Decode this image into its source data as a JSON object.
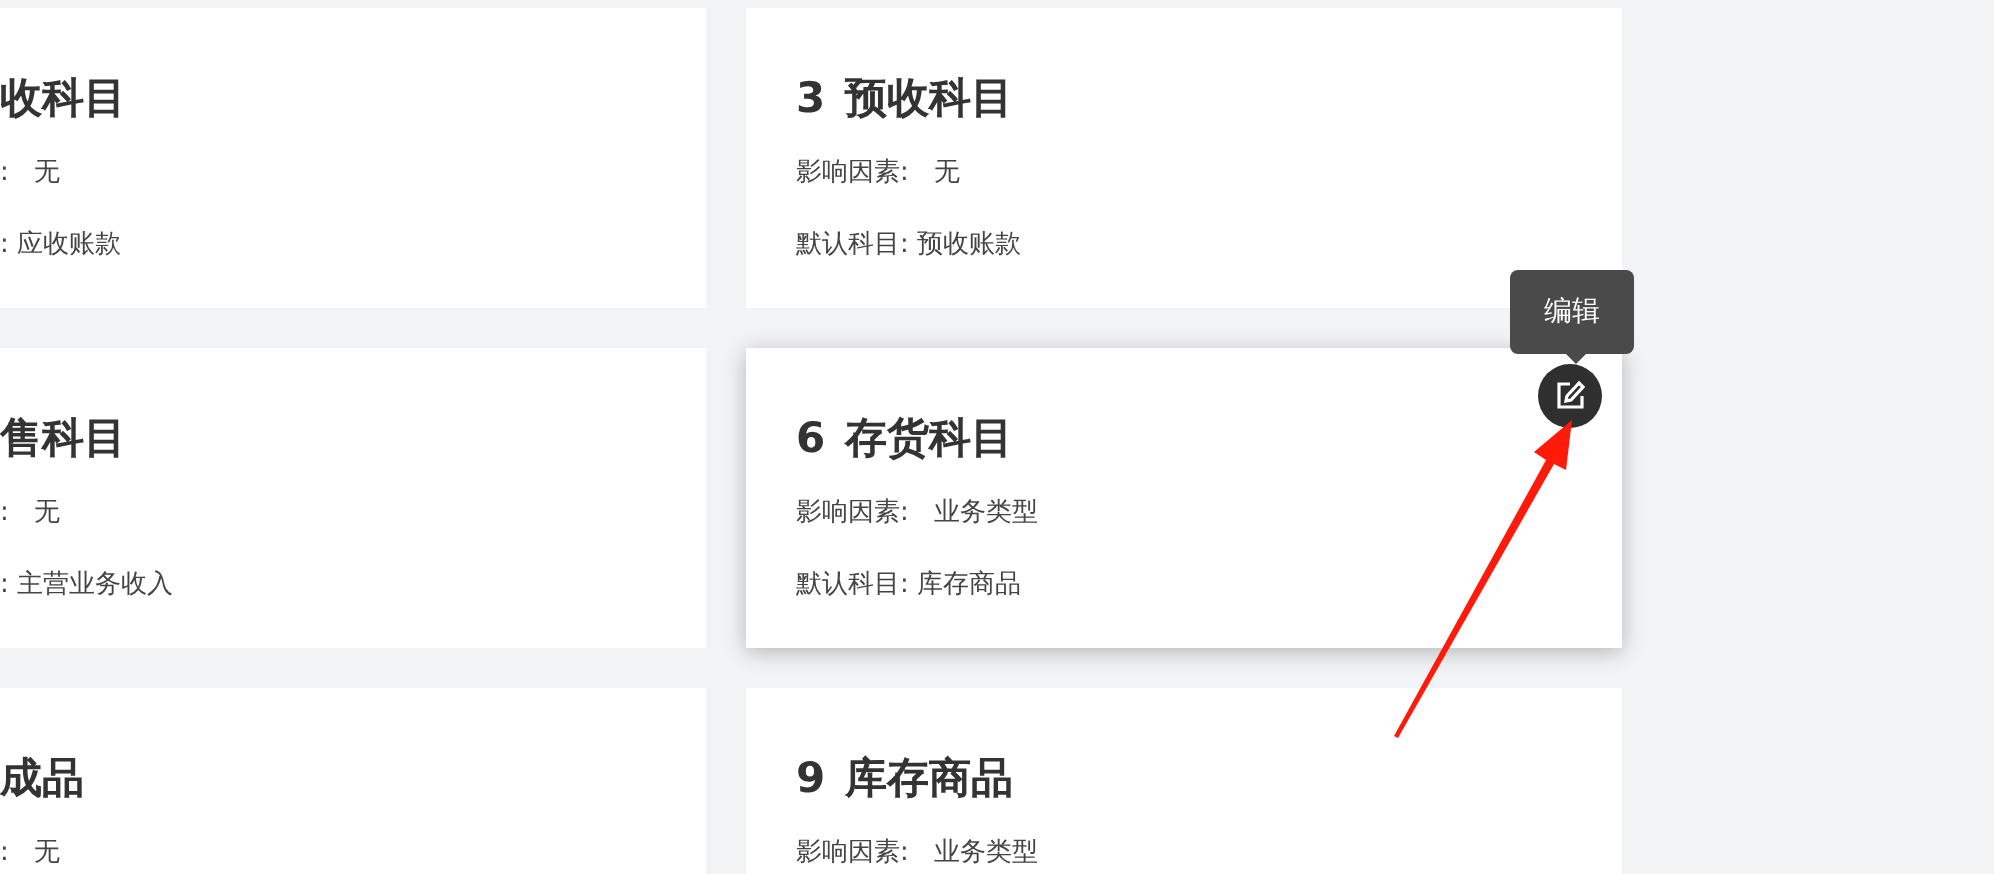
{
  "cards": [
    {
      "title": "收科目",
      "fields": [
        ":   无",
        ": 应收账款"
      ],
      "hovered": false
    },
    {
      "number": "3",
      "title": "预收科目",
      "fields": [
        "影响因素:   无",
        "默认科目: 预收账款"
      ],
      "hovered": false
    },
    {
      "title": "售科目",
      "fields": [
        ":   无",
        ": 主营业务收入"
      ],
      "hovered": false
    },
    {
      "number": "6",
      "title": "存货科目",
      "fields": [
        "影响因素:   业务类型",
        "默认科目: 库存商品"
      ],
      "hovered": true
    },
    {
      "title": "成品",
      "fields": [
        ":   无"
      ],
      "hovered": false
    },
    {
      "number": "9",
      "title": "库存商品",
      "fields": [
        "影响因素:   业务类型"
      ],
      "hovered": false
    }
  ],
  "edit_tooltip": "编辑"
}
